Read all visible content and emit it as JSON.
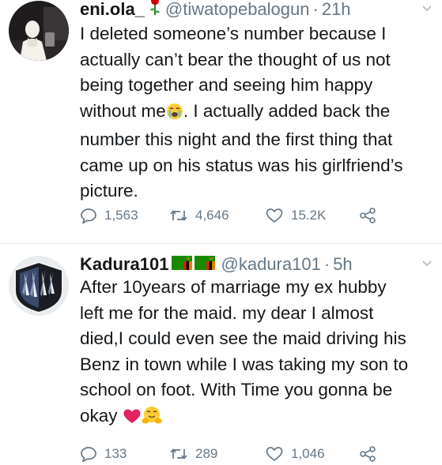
{
  "tweets": [
    {
      "display_name": "eni.ola_",
      "handle": "@tiwatopebalogun",
      "separator": "·",
      "time": "21h",
      "lines": [
        "I deleted someone’s number because I",
        "actually can’t bear the thought of us not",
        "being together and seeing him happy",
        "without me",
        ". I actually added back the",
        "number this night and the first thing that",
        "came up on his status was his girlfriend’s",
        "picture."
      ],
      "replies": "1,563",
      "retweets": "4,646",
      "likes": "15.2K"
    },
    {
      "display_name": "Kadura101",
      "handle": "@kadura101",
      "separator": "·",
      "time": "5h",
      "lines": [
        "After 10years of marriage my ex hubby",
        "left me for the maid. my dear I almost",
        "died,I could even see the maid driving his",
        "Benz in town while I was taking my son to",
        "school on foot. With Time you gonna be",
        "okay"
      ],
      "replies": "133",
      "retweets": "289",
      "likes": "1,046"
    }
  ],
  "icons": {
    "name_emoji_1": "rose-icon",
    "name_emoji_2": "zambia-flag-icon",
    "inline_emoji_1": "crying-face-icon",
    "inline_emoji_2": "red-heart-icon",
    "inline_emoji_3": "hugging-face-icon",
    "reply": "reply-icon",
    "retweet": "retweet-icon",
    "like": "like-icon",
    "share": "share-icon"
  },
  "colors": {
    "text": "#14171a",
    "secondary": "#657786",
    "divider": "#e1e8ed"
  }
}
